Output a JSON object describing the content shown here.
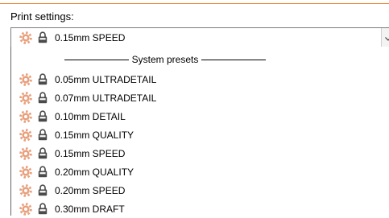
{
  "print_settings": {
    "label": "Print settings:",
    "selected": "0.15mm SPEED",
    "group_header": "System presets",
    "presets": [
      {
        "name": "0.05mm ULTRADETAIL"
      },
      {
        "name": "0.07mm ULTRADETAIL"
      },
      {
        "name": "0.10mm DETAIL"
      },
      {
        "name": "0.15mm QUALITY"
      },
      {
        "name": "0.15mm SPEED"
      },
      {
        "name": "0.20mm QUALITY"
      },
      {
        "name": "0.20mm SPEED"
      },
      {
        "name": "0.30mm DRAFT"
      }
    ]
  },
  "icons": {
    "preset": "gear-icon",
    "locked": "lock-icon",
    "expand": "chevron-down-icon"
  },
  "colors": {
    "accent_line": "#f47b20",
    "gear": "#e8a07d",
    "lock": "#4a4a4a"
  }
}
